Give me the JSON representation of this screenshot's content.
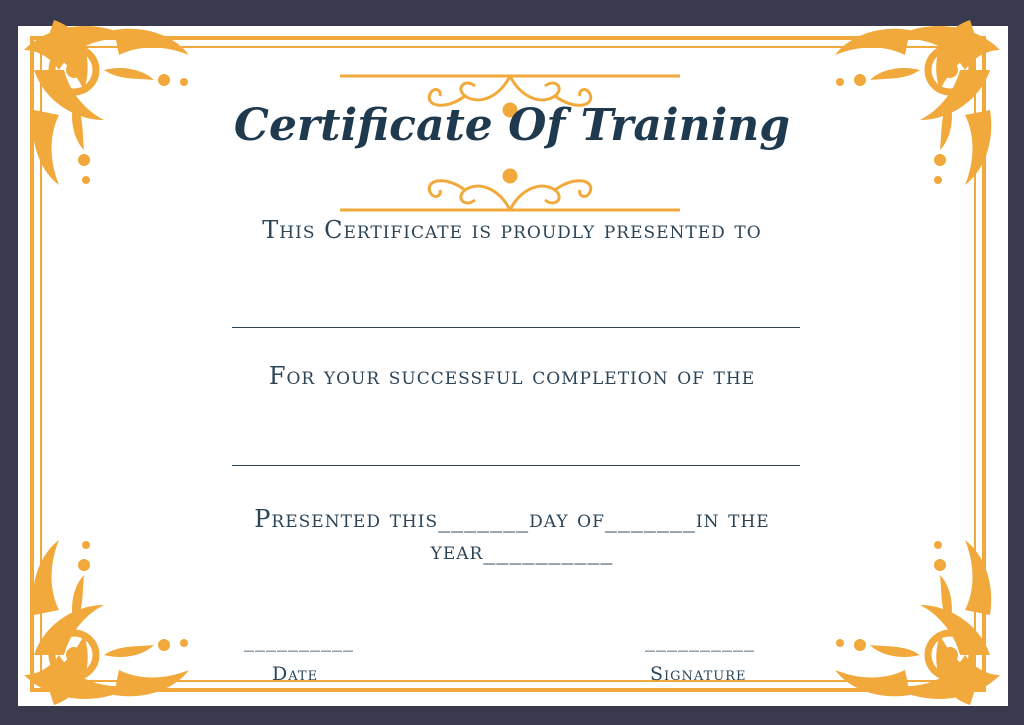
{
  "certificate": {
    "title": "Certificate Of Training",
    "presented_to": "This Certificate is proudly presented to",
    "completion": "For your successful completion of the",
    "presented_line": "Presented this_______day of_______in the",
    "year_line": "year__________",
    "date_line": "__________",
    "signature_line": "__________",
    "date_label": "Date",
    "signature_label": "Signature"
  },
  "colors": {
    "outer_background": "#3a3a4e",
    "paper": "#ffffff",
    "ornament": "#f2a93b",
    "text": "#1f3a4f"
  }
}
